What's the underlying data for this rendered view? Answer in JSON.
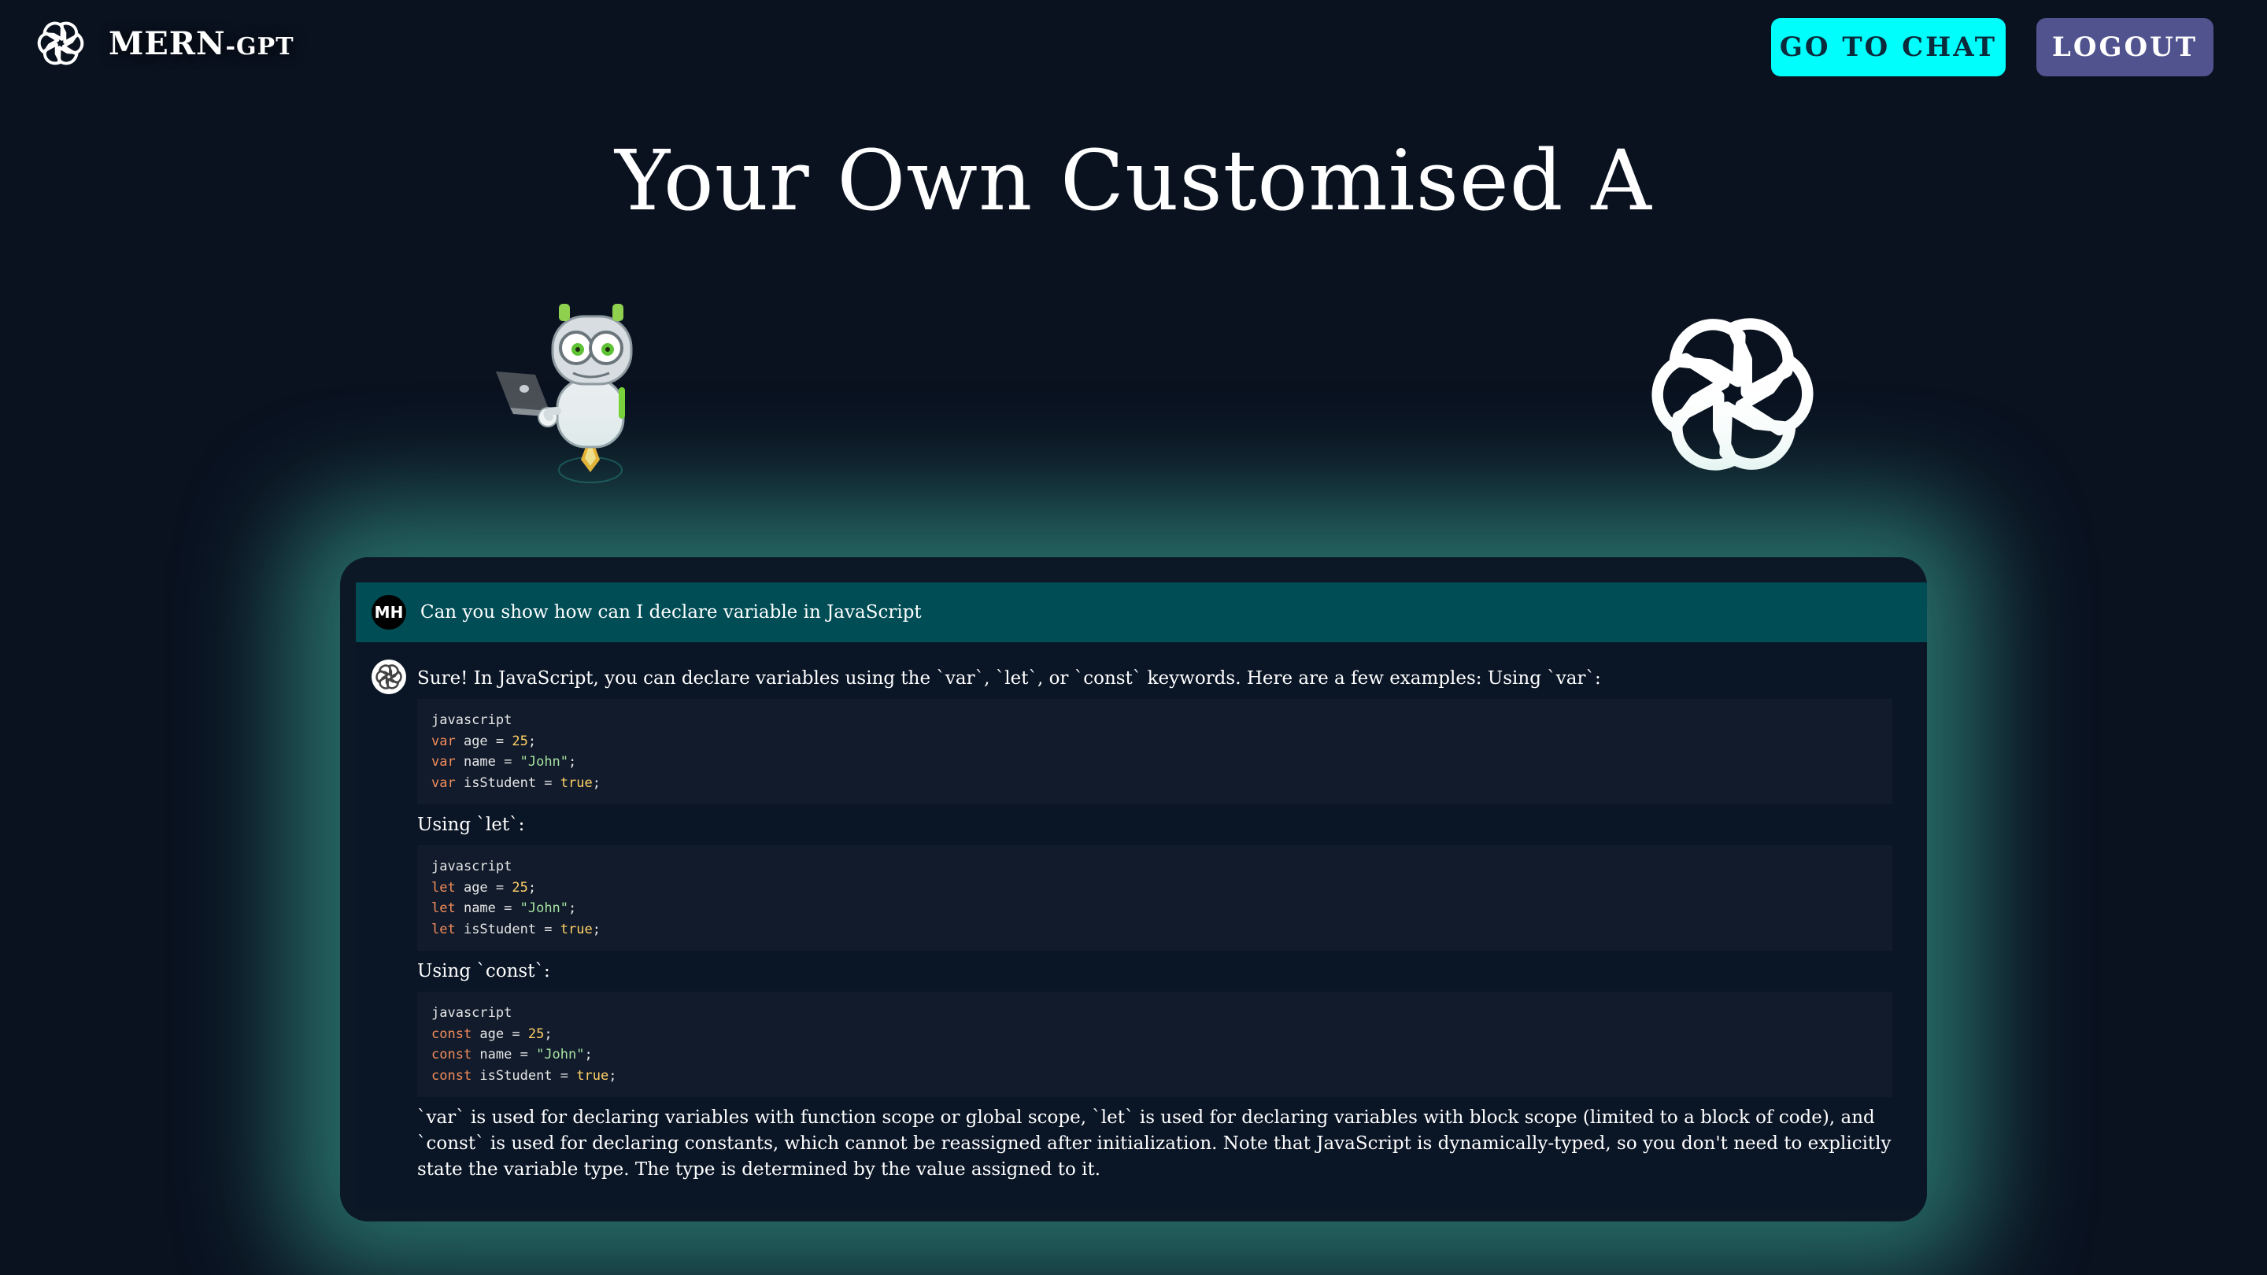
{
  "brand": {
    "name": "MERN",
    "suffix": "-GPT",
    "logo_icon": "openai-logo-icon"
  },
  "nav": {
    "chat_label": "GO TO CHAT",
    "logout_label": "LOGOUT",
    "chat_color": "#00fffc",
    "logout_color": "#51538f"
  },
  "hero": {
    "title": "Your Own Customised A"
  },
  "chat": {
    "user": {
      "initials": "MH",
      "message": "Can you show how can I declare variable in JavaScript"
    },
    "assistant": {
      "intro": "Sure! In JavaScript, you can declare variables using the `var`, `let`, or `const` keywords. Here are a few examples: Using `var`:",
      "blocks": [
        {
          "lang": "javascript",
          "lines": [
            {
              "kw": "var",
              "ident": " age = ",
              "val": "25",
              "type": "num"
            },
            {
              "kw": "var",
              "ident": " name = ",
              "val": "\"John\"",
              "type": "str"
            },
            {
              "kw": "var",
              "ident": " isStudent = ",
              "val": "true",
              "type": "num"
            }
          ]
        },
        {
          "label": "Using `let`:",
          "lang": "javascript",
          "lines": [
            {
              "kw": "let",
              "ident": " age = ",
              "val": "25",
              "type": "num"
            },
            {
              "kw": "let",
              "ident": " name = ",
              "val": "\"John\"",
              "type": "str"
            },
            {
              "kw": "let",
              "ident": " isStudent = ",
              "val": "true",
              "type": "num"
            }
          ]
        },
        {
          "label": "Using `const`:",
          "lang": "javascript",
          "lines": [
            {
              "kw": "const",
              "ident": " age = ",
              "val": "25",
              "type": "num"
            },
            {
              "kw": "const",
              "ident": " name = ",
              "val": "\"John\"",
              "type": "str"
            },
            {
              "kw": "const",
              "ident": " isStudent = ",
              "val": "true",
              "type": "num"
            }
          ]
        }
      ],
      "outro": "`var` is used for declaring variables with function scope or global scope, `let` is used for declaring variables with block scope (limited to a block of code), and `const` is used for declaring constants, which cannot be reassigned after initialization. Note that JavaScript is dynamically-typed, so you don't need to explicitly state the variable type. The type is determined by the value assigned to it."
    }
  },
  "decor": {
    "robot_icon": "robot-with-laptop-icon",
    "openai_icon": "openai-logo-icon",
    "glow_color": "#40b6a0"
  }
}
